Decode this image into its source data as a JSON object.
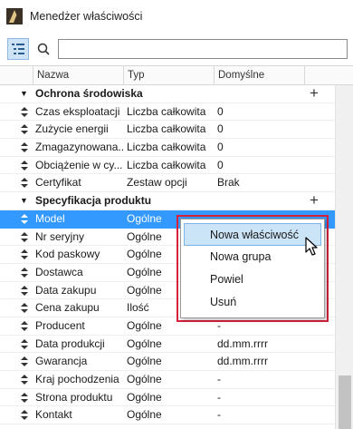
{
  "window": {
    "title": "Menedżer właściwości"
  },
  "toolbar": {
    "search_value": "",
    "search_placeholder": ""
  },
  "columns": {
    "name": "Nazwa",
    "type": "Typ",
    "default": "Domyślne"
  },
  "rows": [
    {
      "kind": "group",
      "name": "Ochrona środowiska"
    },
    {
      "kind": "item",
      "name": "Czas eksploatacji",
      "type": "Liczba całkowita",
      "default": "0"
    },
    {
      "kind": "item",
      "name": "Zużycie energii",
      "type": "Liczba całkowita",
      "default": "0"
    },
    {
      "kind": "item",
      "name": "Zmagazynowana...",
      "type": "Liczba całkowita",
      "default": "0"
    },
    {
      "kind": "item",
      "name": "Obciążenie w cy...",
      "type": "Liczba całkowita",
      "default": "0"
    },
    {
      "kind": "item",
      "name": "Certyfikat",
      "type": "Zestaw opcji",
      "default": "Brak"
    },
    {
      "kind": "group",
      "name": "Specyfikacja produktu"
    },
    {
      "kind": "item",
      "name": "Model",
      "type": "Ogólne",
      "default": "",
      "selected": true
    },
    {
      "kind": "item",
      "name": "Nr seryjny",
      "type": "Ogólne",
      "default": ""
    },
    {
      "kind": "item",
      "name": "Kod paskowy",
      "type": "Ogólne",
      "default": ""
    },
    {
      "kind": "item",
      "name": "Dostawca",
      "type": "Ogólne",
      "default": ""
    },
    {
      "kind": "item",
      "name": "Data zakupu",
      "type": "Ogólne",
      "default": ""
    },
    {
      "kind": "item",
      "name": "Cena zakupu",
      "type": "Ilość",
      "default": ""
    },
    {
      "kind": "item",
      "name": "Producent",
      "type": "Ogólne",
      "default": "-"
    },
    {
      "kind": "item",
      "name": "Data produkcji",
      "type": "Ogólne",
      "default": "dd.mm.rrrr"
    },
    {
      "kind": "item",
      "name": "Gwarancja",
      "type": "Ogólne",
      "default": "dd.mm.rrrr"
    },
    {
      "kind": "item",
      "name": "Kraj pochodzenia",
      "type": "Ogólne",
      "default": "-"
    },
    {
      "kind": "item",
      "name": "Strona produktu",
      "type": "Ogólne",
      "default": "-"
    },
    {
      "kind": "item",
      "name": "Kontakt",
      "type": "Ogólne",
      "default": "-"
    }
  ],
  "context_menu": {
    "items": [
      "Nowa właściwość",
      "Nowa grupa",
      "Powiel",
      "Usuń"
    ],
    "highlighted": 0,
    "outline_color": "#d6203c"
  },
  "colors": {
    "selection": "#3399ff",
    "menu_highlight": "#cce4f7"
  },
  "icons": {
    "drag": "updown-arrows-icon",
    "expand": "triangle-down-icon",
    "add": "plus-icon"
  }
}
